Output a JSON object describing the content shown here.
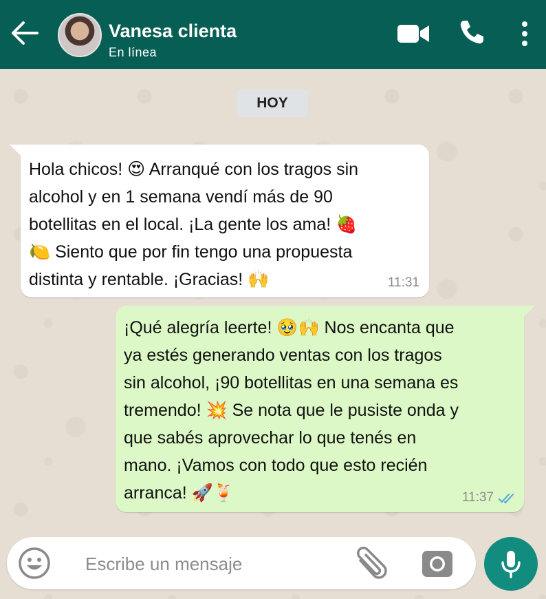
{
  "header": {
    "contact_name": "Vanesa clienta",
    "status": "En línea",
    "back_icon": "arrow-left-icon",
    "video_icon": "video-camera-icon",
    "call_icon": "phone-icon",
    "menu_icon": "more-vertical-icon",
    "color": "#075e54"
  },
  "chat": {
    "date_badge": "HOY",
    "messages": [
      {
        "direction": "incoming",
        "text": "Hola chicos! 😍 Arranqué con los tragos sin\nalcohol y en 1 semana vendí más de 90\nbotellitas en el local. ¡La gente los ama! 🍓\n🍋 Siento que por fin tengo una propuesta\ndistinta y rentable. ¡Gracias! 🙌",
        "time": "11:31"
      },
      {
        "direction": "outgoing",
        "text": "¡Qué alegría leerte! 🥹🙌 Nos encanta que\nya estés generando ventas con los tragos\nsin alcohol, ¡90 botellitas en una semana es\ntremendo! 💥 Se nota que le pusiste onda y\nque sabés aprovechar lo que tenés en\nmano. ¡Vamos con todo que esto recién\narranca! 🚀🍹",
        "time": "11:37",
        "status_icon": "double-check-read-icon",
        "bubble_color": "#dcf8c6"
      }
    ]
  },
  "composer": {
    "placeholder": "Escribe un mensaje",
    "emoji_icon": "emoji-icon",
    "attach_icon": "paperclip-icon",
    "camera_icon": "camera-icon",
    "mic_icon": "microphone-icon",
    "accent": "#128c7e"
  }
}
